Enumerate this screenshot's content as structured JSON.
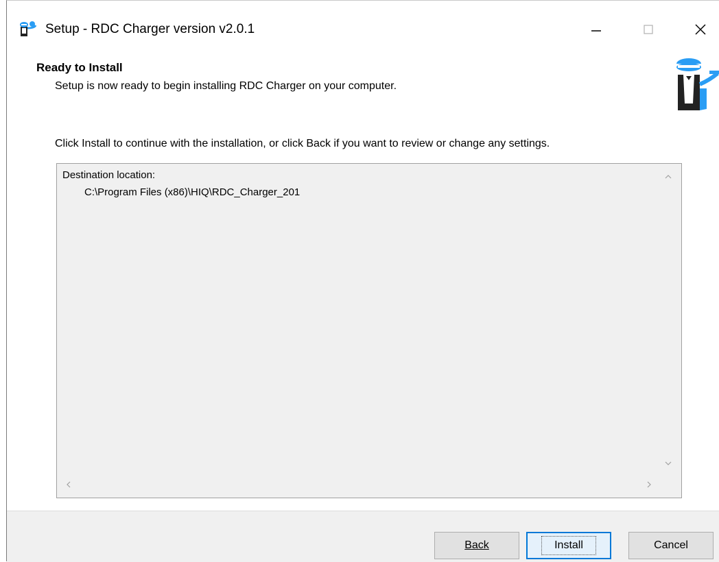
{
  "window": {
    "title": "Setup - RDC Charger version v2.0.1",
    "controls": {
      "minimize_icon": "minimize-icon",
      "maximize_icon": "maximize-icon",
      "close_icon": "close-icon"
    }
  },
  "header": {
    "title": "Ready to Install",
    "subtitle": "Setup is now ready to begin installing RDC Charger on your computer."
  },
  "body": {
    "instruction": "Click Install to continue with the installation, or click Back if you want to review or change any settings.",
    "memo": {
      "line1": "Destination location:",
      "line2": "C:\\Program Files (x86)\\HIQ\\RDC_Charger_201"
    }
  },
  "buttons": {
    "back_label": "Back",
    "install_label": "Install",
    "cancel_label": "Cancel"
  },
  "colors": {
    "accent": "#0078d7",
    "brand_blue": "#2a9df4",
    "panel_bg": "#f0f0f0"
  }
}
